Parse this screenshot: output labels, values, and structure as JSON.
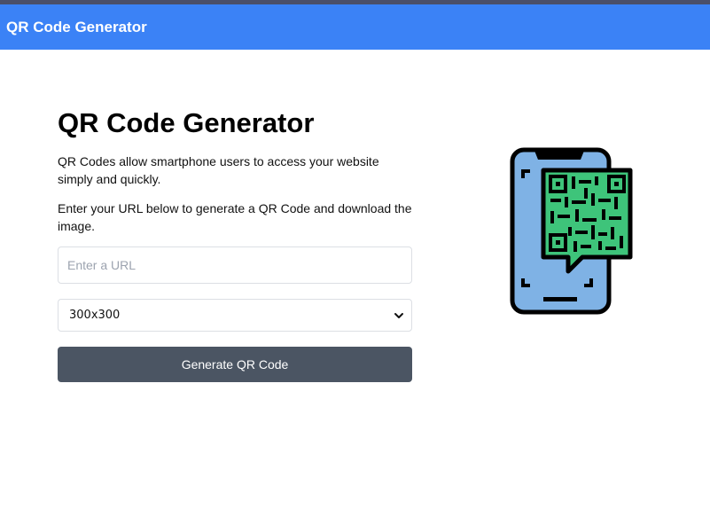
{
  "navbar": {
    "brand": "QR Code Generator"
  },
  "main": {
    "title": "QR Code Generator",
    "intro": "QR Codes allow smartphone users to access your website simply and quickly.",
    "instructions": "Enter your URL below to generate a QR Code and download the image.",
    "url_input": {
      "placeholder": "Enter a URL",
      "value": ""
    },
    "size_select": {
      "selected": "300x300"
    },
    "generate_button": "Generate QR Code"
  },
  "colors": {
    "navbar": "#3b82f6",
    "button": "#4b5563",
    "phone_screen": "#7fb2e5",
    "qr_fill": "#3ec47a"
  },
  "icons": [
    "chevron-down-icon",
    "phone-qr-illustration"
  ]
}
